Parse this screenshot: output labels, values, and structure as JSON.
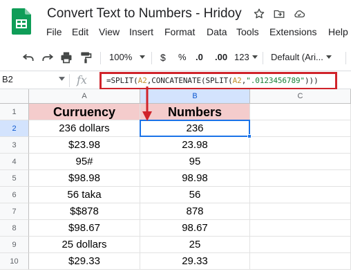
{
  "app": {
    "title": "Convert Text to Numbers - Hridoy"
  },
  "menu": [
    "File",
    "Edit",
    "View",
    "Insert",
    "Format",
    "Data",
    "Tools",
    "Extensions",
    "Help"
  ],
  "toolbar": {
    "zoom": "100%",
    "currency": "$",
    "percent": "%",
    "decrease_decimal": ".0",
    "increase_decimal": ".00",
    "more_formats": "123",
    "font": "Default (Ari..."
  },
  "formula_bar": {
    "cell_ref": "B2",
    "fx": "fx",
    "formula_parts": [
      {
        "text": "=SPLIT(",
        "kind": "fn"
      },
      {
        "text": "A2",
        "kind": "ref"
      },
      {
        "text": ",CONCATENATE(SPLIT(",
        "kind": "fn"
      },
      {
        "text": "A2",
        "kind": "ref"
      },
      {
        "text": ",",
        "kind": "fn"
      },
      {
        "text": "\".0123456789\"",
        "kind": "str"
      },
      {
        "text": ")))",
        "kind": "fn"
      }
    ]
  },
  "grid": {
    "columns": [
      "A",
      "B",
      "C"
    ],
    "active_column": "B",
    "active_row": "2",
    "rows": [
      {
        "num": "1",
        "a": "Curruency",
        "b": "Numbers",
        "c": ""
      },
      {
        "num": "2",
        "a": "236 dollars",
        "b": "236",
        "c": ""
      },
      {
        "num": "3",
        "a": "$23.98",
        "b": "23.98",
        "c": ""
      },
      {
        "num": "4",
        "a": "95#",
        "b": "95",
        "c": ""
      },
      {
        "num": "5",
        "a": "$98.98",
        "b": "98.98",
        "c": ""
      },
      {
        "num": "6",
        "a": "56 taka",
        "b": "56",
        "c": ""
      },
      {
        "num": "7",
        "a": "$$878",
        "b": "878",
        "c": ""
      },
      {
        "num": "8",
        "a": "$98.67",
        "b": "98.67",
        "c": ""
      },
      {
        "num": "9",
        "a": "25 dollars",
        "b": "25",
        "c": ""
      },
      {
        "num": "10",
        "a": "$29.33",
        "b": "29.33",
        "c": ""
      }
    ]
  },
  "colors": {
    "header_fill": "#f4cccc",
    "selection": "#1a73e8",
    "annotation": "#d0232a"
  }
}
